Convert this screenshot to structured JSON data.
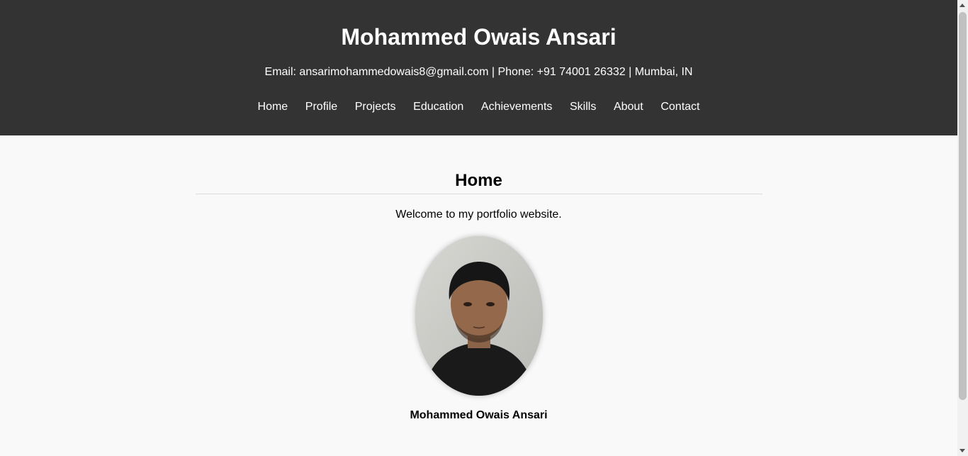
{
  "header": {
    "title": "Mohammed Owais Ansari",
    "contact": "Email: ansarimohammedowais8@gmail.com | Phone: +91 74001 26332 | Mumbai, IN"
  },
  "nav": {
    "items": [
      {
        "label": "Home"
      },
      {
        "label": "Profile"
      },
      {
        "label": "Projects"
      },
      {
        "label": "Education"
      },
      {
        "label": "Achievements"
      },
      {
        "label": "Skills"
      },
      {
        "label": "About"
      },
      {
        "label": "Contact"
      }
    ]
  },
  "home": {
    "title": "Home",
    "welcome": "Welcome to my portfolio website.",
    "caption": "Mohammed Owais Ansari"
  },
  "colors": {
    "header_bg": "#333333",
    "page_bg": "#f9f9f9",
    "divider": "#dddddd"
  }
}
